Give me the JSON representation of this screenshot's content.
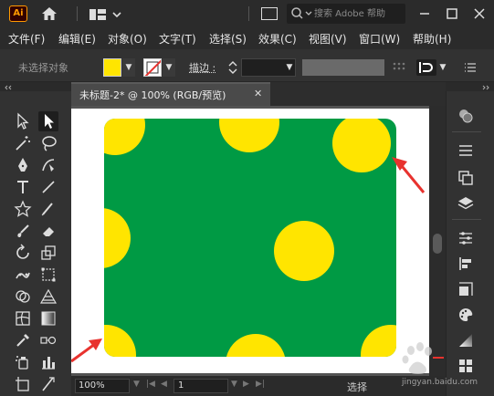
{
  "app": {
    "logo_text": "Ai"
  },
  "titlebar": {
    "search_placeholder": "搜索 Adobe 帮助"
  },
  "menu": [
    {
      "label": "文件(F)"
    },
    {
      "label": "编辑(E)"
    },
    {
      "label": "对象(O)"
    },
    {
      "label": "文字(T)"
    },
    {
      "label": "选择(S)"
    },
    {
      "label": "效果(C)"
    },
    {
      "label": "视图(V)"
    },
    {
      "label": "窗口(W)"
    },
    {
      "label": "帮助(H)"
    }
  ],
  "control_bar": {
    "selection_label": "未选择对象",
    "fill_color": "#ffe500",
    "stroke_label": "描边 :"
  },
  "document": {
    "tab_label": "未标题-2* @ 100% (RGB/预览)",
    "close_label": "✕"
  },
  "artwork": {
    "artboard_color": "#ffffff",
    "background_color": "#009a44",
    "dot_color": "#ffe500",
    "arrow_color": "#e8322e"
  },
  "status": {
    "zoom": "100%",
    "page": "1",
    "text": "选择"
  },
  "watermark": {
    "text": "jingyan.baidu.com"
  }
}
